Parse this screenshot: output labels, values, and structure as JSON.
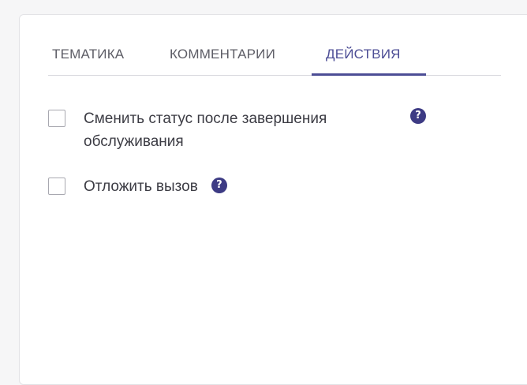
{
  "tabs": [
    {
      "label": "ТЕМАТИКА",
      "active": false
    },
    {
      "label": "КОММЕНТАРИИ",
      "active": false
    },
    {
      "label": "ДЕЙСТВИЯ",
      "active": true
    }
  ],
  "actions": {
    "change_status": {
      "label": "Сменить статус после завершения обслуживания",
      "checked": false,
      "help_icon": "?"
    },
    "postpone_call": {
      "label": "Отложить вызов",
      "checked": false,
      "help_icon": "?"
    }
  },
  "colors": {
    "accent": "#4c4d95",
    "help_icon": "#3d3b84",
    "tab_text": "#5d5d66",
    "label_text": "#3c3c44"
  }
}
